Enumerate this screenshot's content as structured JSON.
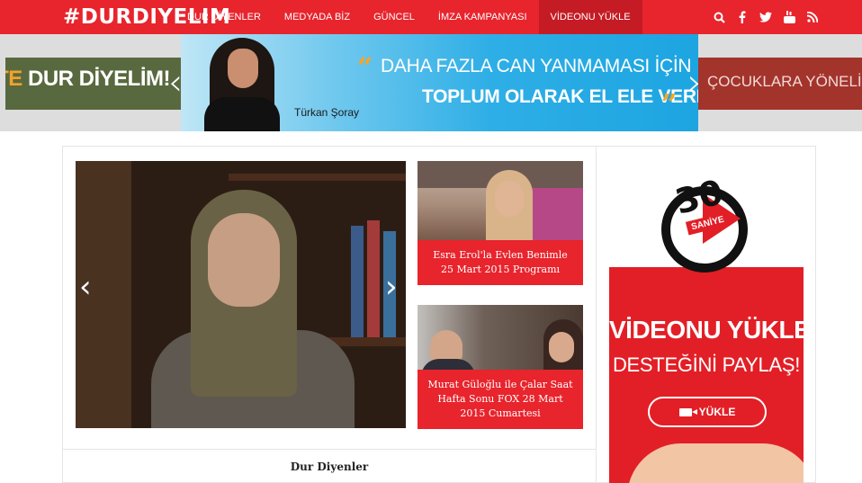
{
  "header": {
    "logo": "#DURDIYELIM",
    "nav": [
      "DUR DİYENLER",
      "MEDYADA BİZ",
      "GÜNCEL",
      "İMZA KAMPANYASI",
      "VİDEONU YÜKLE"
    ],
    "active_nav": "VİDEONU YÜKLE",
    "social_icons": [
      "search-icon",
      "facebook-icon",
      "twitter-icon",
      "youtube-icon",
      "rss-icon"
    ],
    "brand_color": "#e8242d"
  },
  "banner": {
    "left_text_highlight": "RLİKTE",
    "left_text": " DUR DİYELİM!",
    "right_text": "ÇOCUKLARA YÖNELİK Ş",
    "quote_line1": "DAHA FAZLA CAN YANMAMASI İÇİN",
    "quote_line2": "TOPLUM OLARAK EL ELE VERMELİYİZ.",
    "caption": "Türkan Şoray",
    "prev_arrow": "‹",
    "next_arrow": "›"
  },
  "slider": {
    "prev_arrow": "‹",
    "next_arrow": "›"
  },
  "videos": [
    {
      "title": "Esra Erol'la Evlen Benimle 25 Mart 2015 Programı"
    },
    {
      "title": "Murat Güloğlu ile Çalar Saat Hafta Sonu FOX 28 Mart 2015 Cumartesi"
    }
  ],
  "section_title": "Dur Diyenler",
  "ad": {
    "number": "30",
    "saniye": "SANİYE",
    "title": "VİDEONU YÜKLE",
    "subtitle": "DESTEĞİNİ PAYLAŞ!",
    "button_label": "YÜKLE"
  }
}
